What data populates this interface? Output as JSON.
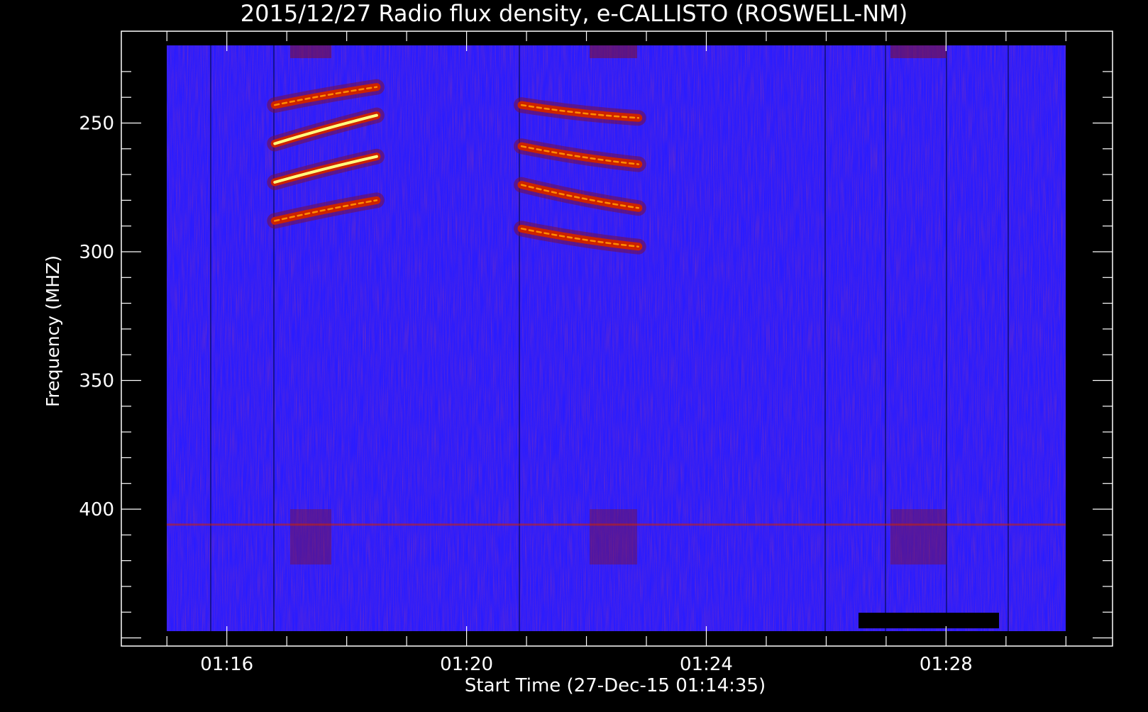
{
  "chart_data": {
    "type": "heatmap",
    "title": "2015/12/27  Radio flux density, e-CALLISTO (ROSWELL-NM)",
    "xlabel": "Start Time (27-Dec-15 01:14:35)",
    "ylabel": "Frequency (MHZ)",
    "x_ticks": [
      "01:16",
      "01:20",
      "01:24",
      "01:28"
    ],
    "y_ticks": [
      250,
      300,
      350,
      400
    ],
    "y_axis_inverted": true,
    "colormap": {
      "background": "#2a1cff",
      "low": "#7a0f3a",
      "mid": "#cc2200",
      "high": "#ff8c00",
      "peak": "#ffff80"
    },
    "bursts": [
      {
        "start_time": "01:16:48",
        "end_time": "01:18:30",
        "lanes": [
          {
            "start_freq": 243,
            "end_freq": 236
          },
          {
            "start_freq": 258,
            "end_freq": 247
          },
          {
            "start_freq": 273,
            "end_freq": 263
          },
          {
            "start_freq": 288,
            "end_freq": 280
          }
        ]
      },
      {
        "start_time": "01:20:55",
        "end_time": "01:22:52",
        "lanes": [
          {
            "start_freq": 243,
            "end_freq": 248
          },
          {
            "start_freq": 259,
            "end_freq": 266
          },
          {
            "start_freq": 274,
            "end_freq": 283
          },
          {
            "start_freq": 291,
            "end_freq": 298
          }
        ]
      }
    ]
  }
}
